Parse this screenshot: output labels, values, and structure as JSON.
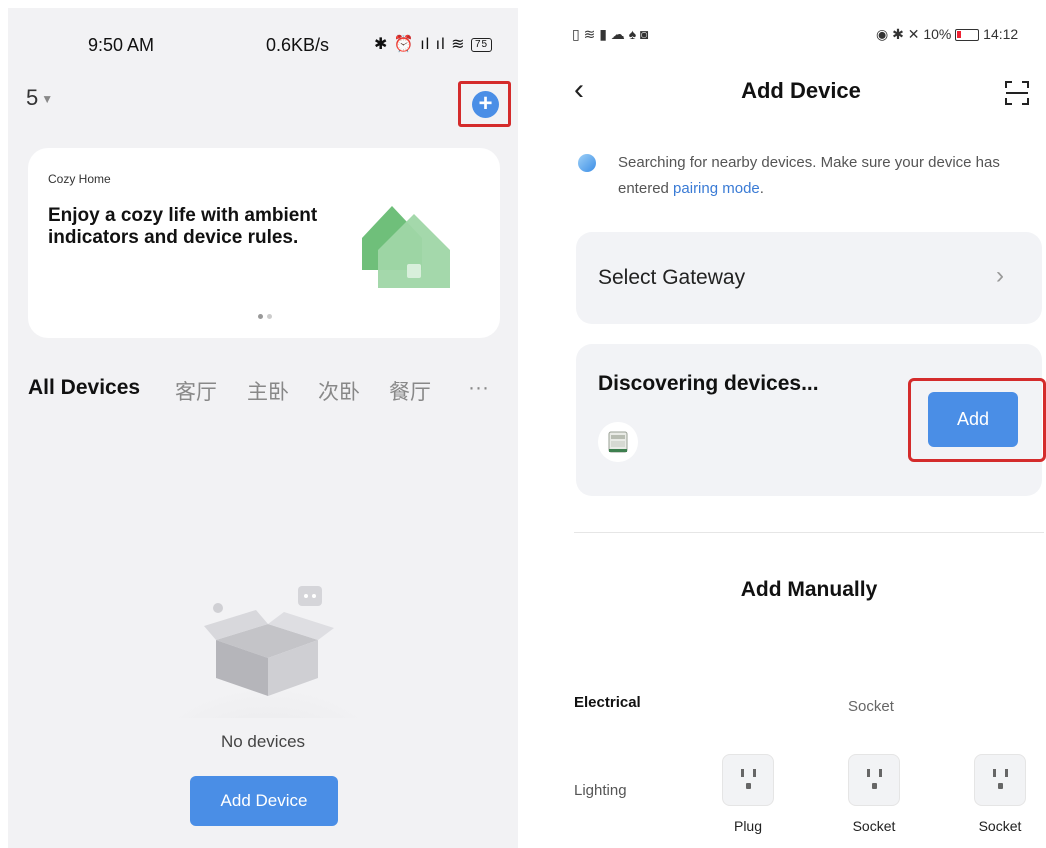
{
  "left": {
    "status": {
      "time": "9:50 AM",
      "rate": "0.6KB/s",
      "icons": "✱ ⏰ ıl ıl ≋",
      "battery": "75"
    },
    "home_selector": "5",
    "banner": {
      "small": "Cozy Home",
      "title": "Enjoy a cozy life with ambient indicators and device rules."
    },
    "tabs": [
      "All Devices",
      "客厅",
      "主卧",
      "次卧",
      "餐厅",
      "···"
    ],
    "empty_text": "No devices",
    "add_device_label": "Add Device"
  },
  "right": {
    "status": {
      "left_icons": "▯ ≋ ▮ ☁ ♠ ◙",
      "right_icons": "◉ ✱ ✕ 10%",
      "time": "14:12"
    },
    "title": "Add Device",
    "notice_prefix": "Searching for nearby devices. Make sure your device has entered ",
    "notice_link": "pairing mode",
    "notice_suffix": ".",
    "gateway_label": "Select Gateway",
    "discover_title": "Discovering devices...",
    "add_label": "Add",
    "manual_title": "Add Manually",
    "categories": [
      "Electrical",
      "Lighting"
    ],
    "section_header": "Socket",
    "devices": [
      "Plug",
      "Socket",
      "Socket"
    ]
  },
  "colors": {
    "accent": "#4a8ee6",
    "highlight": "#d42b2b",
    "link": "#3a7bd5"
  }
}
